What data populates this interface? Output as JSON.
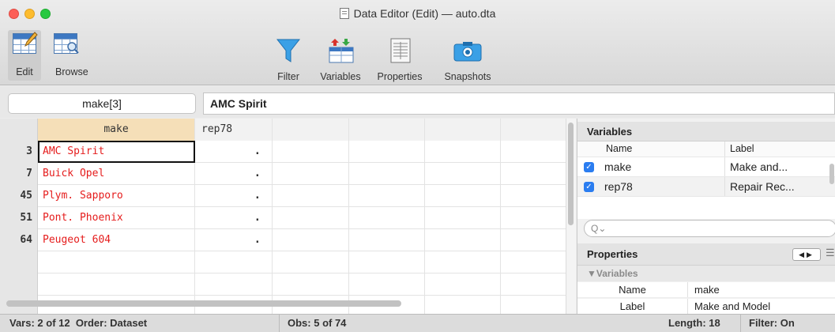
{
  "window": {
    "title": "Data Editor (Edit) — auto.dta"
  },
  "toolbar": {
    "edit_label": "Edit",
    "browse_label": "Browse",
    "filter_label": "Filter",
    "variables_label": "Variables",
    "properties_label": "Properties",
    "snapshots_label": "Snapshots"
  },
  "refbar": {
    "cell_ref": "make[3]",
    "cell_value": "AMC Spirit"
  },
  "grid": {
    "headers": [
      "make",
      "rep78"
    ],
    "rows": [
      {
        "obs": "3",
        "make": "AMC Spirit",
        "rep78": "."
      },
      {
        "obs": "7",
        "make": "Buick Opel",
        "rep78": "."
      },
      {
        "obs": "45",
        "make": "Plym. Sapporo",
        "rep78": "."
      },
      {
        "obs": "51",
        "make": "Pont. Phoenix",
        "rep78": "."
      },
      {
        "obs": "64",
        "make": "Peugeot 604",
        "rep78": "."
      }
    ]
  },
  "variables_panel": {
    "title": "Variables",
    "col_name": "Name",
    "col_label": "Label",
    "items": [
      {
        "name": "make",
        "label": "Make and..."
      },
      {
        "name": "rep78",
        "label": "Repair Rec..."
      }
    ],
    "search_placeholder": "Q⌄"
  },
  "properties_panel": {
    "title": "Properties",
    "group": "▼Variables",
    "rows": [
      {
        "key": "Name",
        "value": "make"
      },
      {
        "key": "Label",
        "value": "Make and Model"
      }
    ]
  },
  "status": {
    "vars": "Vars: 2 of 12  Order: Dataset",
    "obs": "Obs: 5 of 74",
    "length": "Length: 18",
    "filter": "Filter: On"
  },
  "colors": {
    "string_text": "#e51c1c",
    "selected_header": "#f5dfb8",
    "checkbox": "#2b7df0"
  }
}
